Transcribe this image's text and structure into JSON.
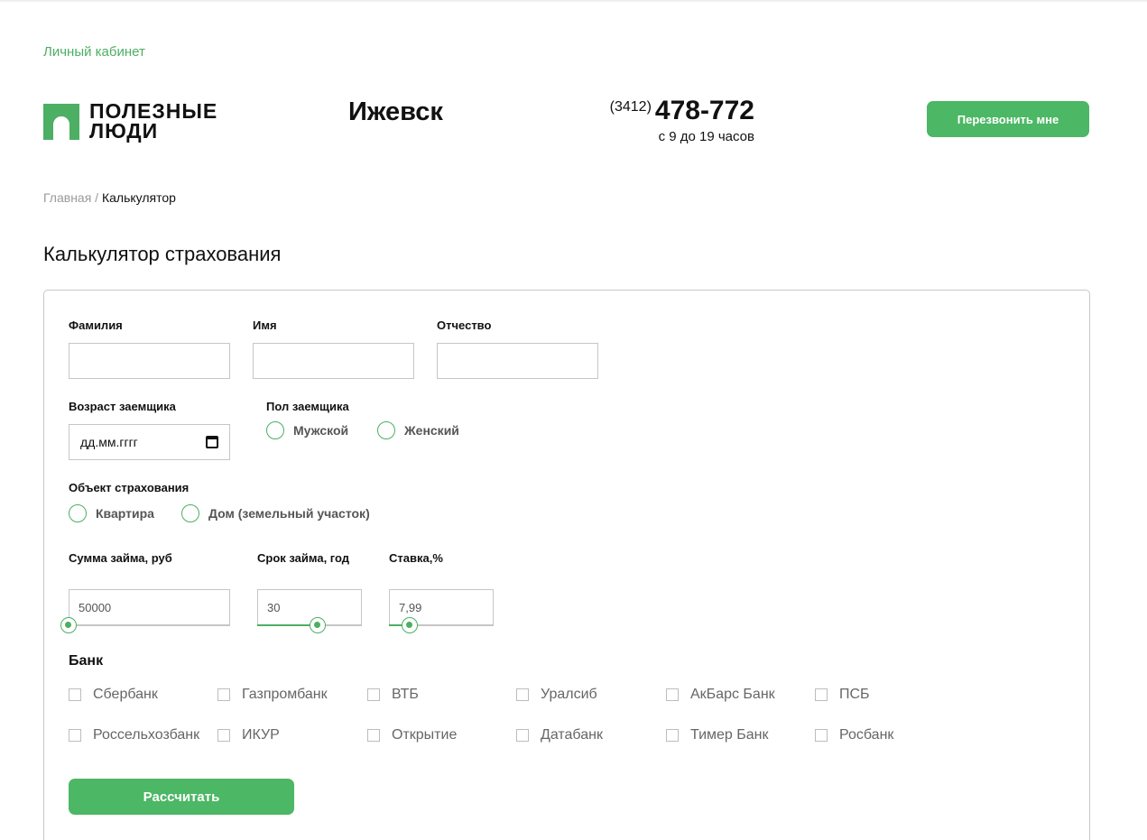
{
  "header": {
    "cabinet_link": "Личный кабинет",
    "logo_line1": "ПОЛЕЗНЫЕ",
    "logo_line2": "ЛЮДИ",
    "city": "Ижевск",
    "phone_code": "(3412)",
    "phone_number": "478-772",
    "hours": "с 9 до 19 часов",
    "callback_button": "Перезвонить мне"
  },
  "breadcrumb": {
    "home": "Главная",
    "separator": " / ",
    "current": "Калькулятор"
  },
  "page_title": "Калькулятор страхования",
  "form": {
    "last_name_label": "Фамилия",
    "last_name_value": "",
    "first_name_label": "Имя",
    "first_name_value": "",
    "patronymic_label": "Отчество",
    "patronymic_value": "",
    "age_label": "Возраст заемщика",
    "age_placeholder": "дд.мм.гггг",
    "gender_label": "Пол заемщика",
    "gender_options": [
      "Мужской",
      "Женский"
    ],
    "object_label": "Объект страхования",
    "object_options": [
      "Квартира",
      "Дом (земельный участок)"
    ],
    "loan_amount_label": "Сумма займа, руб",
    "loan_amount_value": "50000",
    "loan_amount_level": 0,
    "loan_term_label": "Срок займа, год",
    "loan_term_value": "30",
    "loan_term_level": 0.58,
    "rate_label": "Ставка,%",
    "rate_value": "7,99",
    "rate_level": 0.2,
    "bank_label": "Банк",
    "banks": [
      "Сбербанк",
      "Газпромбанк",
      "ВТБ",
      "Уралсиб",
      "АкБарс Банк",
      "ПСБ",
      "Россельхозбанк",
      "ИКУР",
      "Открытие",
      "Датабанк",
      "Тимер Банк",
      "Росбанк"
    ],
    "submit_button": "Рассчитать"
  },
  "colors": {
    "accent": "#4cb765",
    "link": "#4caf63",
    "border": "#c6c6c6"
  },
  "icons": {
    "date_picker": "calendar-icon",
    "logo": "logo-arch-icon"
  }
}
